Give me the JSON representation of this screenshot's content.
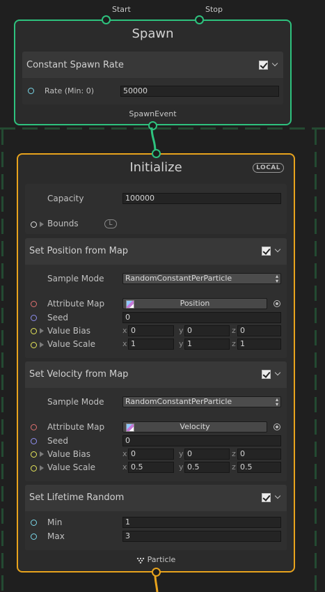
{
  "spawn": {
    "title": "Spawn",
    "ports_in": [
      "Start",
      "Stop"
    ],
    "port_out": "SpawnEvent",
    "blocks": [
      {
        "title": "Constant Spawn Rate",
        "enabled": true,
        "rows": [
          {
            "label": "Rate (Min: 0)",
            "value": "50000"
          }
        ]
      }
    ]
  },
  "initialize": {
    "title": "Initialize",
    "space_badge": "LOCAL",
    "port_out": "Particle",
    "capacity": {
      "label": "Capacity",
      "value": "100000"
    },
    "bounds": {
      "label": "Bounds",
      "badge": "L"
    },
    "blocks": [
      {
        "title": "Set Position from Map",
        "enabled": true,
        "sample_mode": {
          "label": "Sample Mode",
          "value": "RandomConstantPerParticle"
        },
        "attribute_map": {
          "label": "Attribute Map",
          "value": "Position"
        },
        "seed": {
          "label": "Seed",
          "value": "0"
        },
        "value_bias": {
          "label": "Value Bias",
          "x": "0",
          "y": "0",
          "z": "0"
        },
        "value_scale": {
          "label": "Value Scale",
          "x": "1",
          "y": "1",
          "z": "1"
        }
      },
      {
        "title": "Set Velocity from Map",
        "enabled": true,
        "sample_mode": {
          "label": "Sample Mode",
          "value": "RandomConstantPerParticle"
        },
        "attribute_map": {
          "label": "Attribute Map",
          "value": "Velocity"
        },
        "seed": {
          "label": "Seed",
          "value": "0"
        },
        "value_bias": {
          "label": "Value Bias",
          "x": "0",
          "y": "0",
          "z": "0"
        },
        "value_scale": {
          "label": "Value Scale",
          "x": "0.5",
          "y": "0.5",
          "z": "0.5"
        }
      },
      {
        "title": "Set Lifetime Random",
        "enabled": true,
        "min": {
          "label": "Min",
          "value": "1"
        },
        "max": {
          "label": "Max",
          "value": "3"
        }
      }
    ]
  },
  "axes": {
    "x": "x",
    "y": "y",
    "z": "z"
  },
  "colors": {
    "spawn_border": "#2ec27e",
    "init_border": "#e8a31c",
    "background": "#1f1f1f",
    "slot_float": "#7ad8ea",
    "slot_texture": "#e07070",
    "slot_uint": "#8f8ff0",
    "slot_vector": "#e6e65a"
  },
  "icons": {
    "checkbox": "checkmark",
    "collapse": "chevron-down",
    "expand": "triangle-right",
    "object_picker": "target-circle",
    "particle": "particle-dots"
  }
}
